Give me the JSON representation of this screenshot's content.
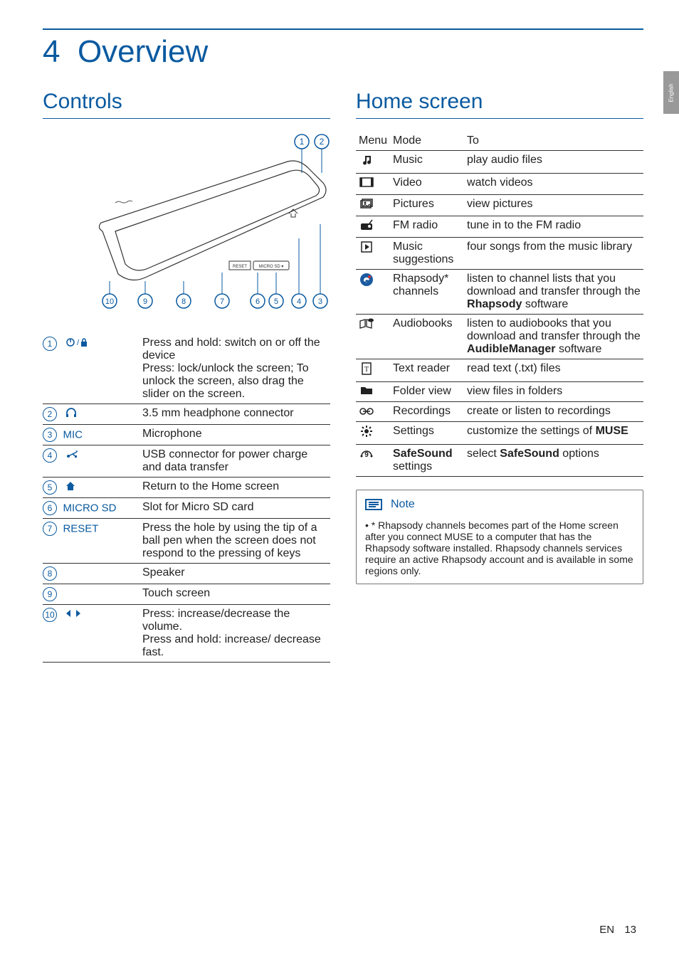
{
  "language_tab": "English",
  "chapter": {
    "number": "4",
    "title": "Overview"
  },
  "sections": {
    "controls": {
      "title": "Controls"
    },
    "home": {
      "title": "Home screen"
    }
  },
  "controls_diagram": {
    "callouts_top": [
      "1",
      "2"
    ],
    "callouts_bottom": [
      "10",
      "9",
      "8",
      "7",
      "6",
      "5",
      "4",
      "3"
    ],
    "reset_label": "RESET",
    "microsd_label": "MICRO SD"
  },
  "controls": [
    {
      "num": "1",
      "label_icon": "power-lock-icon",
      "desc": "Press and hold: switch on or off the device\nPress: lock/unlock the screen; To unlock the screen, also drag the slider on the screen."
    },
    {
      "num": "2",
      "label_icon": "headphone-icon",
      "desc": "3.5 mm headphone connector"
    },
    {
      "num": "3",
      "label_text": "MIC",
      "desc": "Microphone"
    },
    {
      "num": "4",
      "label_icon": "usb-icon",
      "desc": "USB connector for power charge and data transfer"
    },
    {
      "num": "5",
      "label_icon": "home-icon",
      "desc": "Return to the Home screen"
    },
    {
      "num": "6",
      "label_text": "MICRO SD",
      "desc": "Slot for Micro SD card"
    },
    {
      "num": "7",
      "label_text": "RESET",
      "desc": "Press the hole by using the tip of a ball pen when the screen does not respond to the pressing of keys"
    },
    {
      "num": "8",
      "desc": "Speaker"
    },
    {
      "num": "9",
      "desc": "Touch screen"
    },
    {
      "num": "10",
      "label_icon": "volume-icon",
      "desc": "Press: increase/decrease the volume.\nPress and hold: increase/ decrease fast."
    }
  ],
  "menu_headers": {
    "menu": "Menu",
    "mode": "Mode",
    "to": "To"
  },
  "menu": [
    {
      "icon": "music-icon",
      "mode": "Music",
      "to": "play audio files"
    },
    {
      "icon": "video-icon",
      "mode": "Video",
      "to": "watch videos"
    },
    {
      "icon": "pictures-icon",
      "mode": "Pictures",
      "to": "view pictures"
    },
    {
      "icon": "radio-icon",
      "mode": "FM radio",
      "to": "tune in to the FM radio"
    },
    {
      "icon": "suggestions-icon",
      "mode": "Music suggestions",
      "to": "four songs from the music library"
    },
    {
      "icon": "rhapsody-icon",
      "mode": "Rhapsody* channels",
      "to_html": "listen to channel lists that you download and transfer through the <span class=\"bold\">Rhapsody</span> software"
    },
    {
      "icon": "audiobooks-icon",
      "mode": "Audiobooks",
      "to_html": "listen to audiobooks that you download and transfer through the <span class=\"bold\">AudibleManager</span> software"
    },
    {
      "icon": "text-icon",
      "mode": "Text reader",
      "to": "read text (.txt) files"
    },
    {
      "icon": "folder-icon",
      "mode": "Folder view",
      "to": "view files in folders"
    },
    {
      "icon": "recordings-icon",
      "mode": "Recordings",
      "to": "create or listen to recordings"
    },
    {
      "icon": "settings-icon",
      "mode": "Settings",
      "to_html": "customize the settings of <span class=\"bold\">MUSE</span>"
    },
    {
      "icon": "safesound-icon",
      "mode_html": "<span class=\"bold\">SafeSound</span> settings",
      "to_html": "select <span class=\"bold\">SafeSound</span> options"
    }
  ],
  "note": {
    "label": "Note",
    "text": "* Rhapsody channels becomes part of the Home screen after you connect MUSE to a computer that has the Rhapsody software installed. Rhapsody channels services require an active Rhapsody account and is available in some regions only."
  },
  "footer": {
    "lang": "EN",
    "page": "13"
  }
}
